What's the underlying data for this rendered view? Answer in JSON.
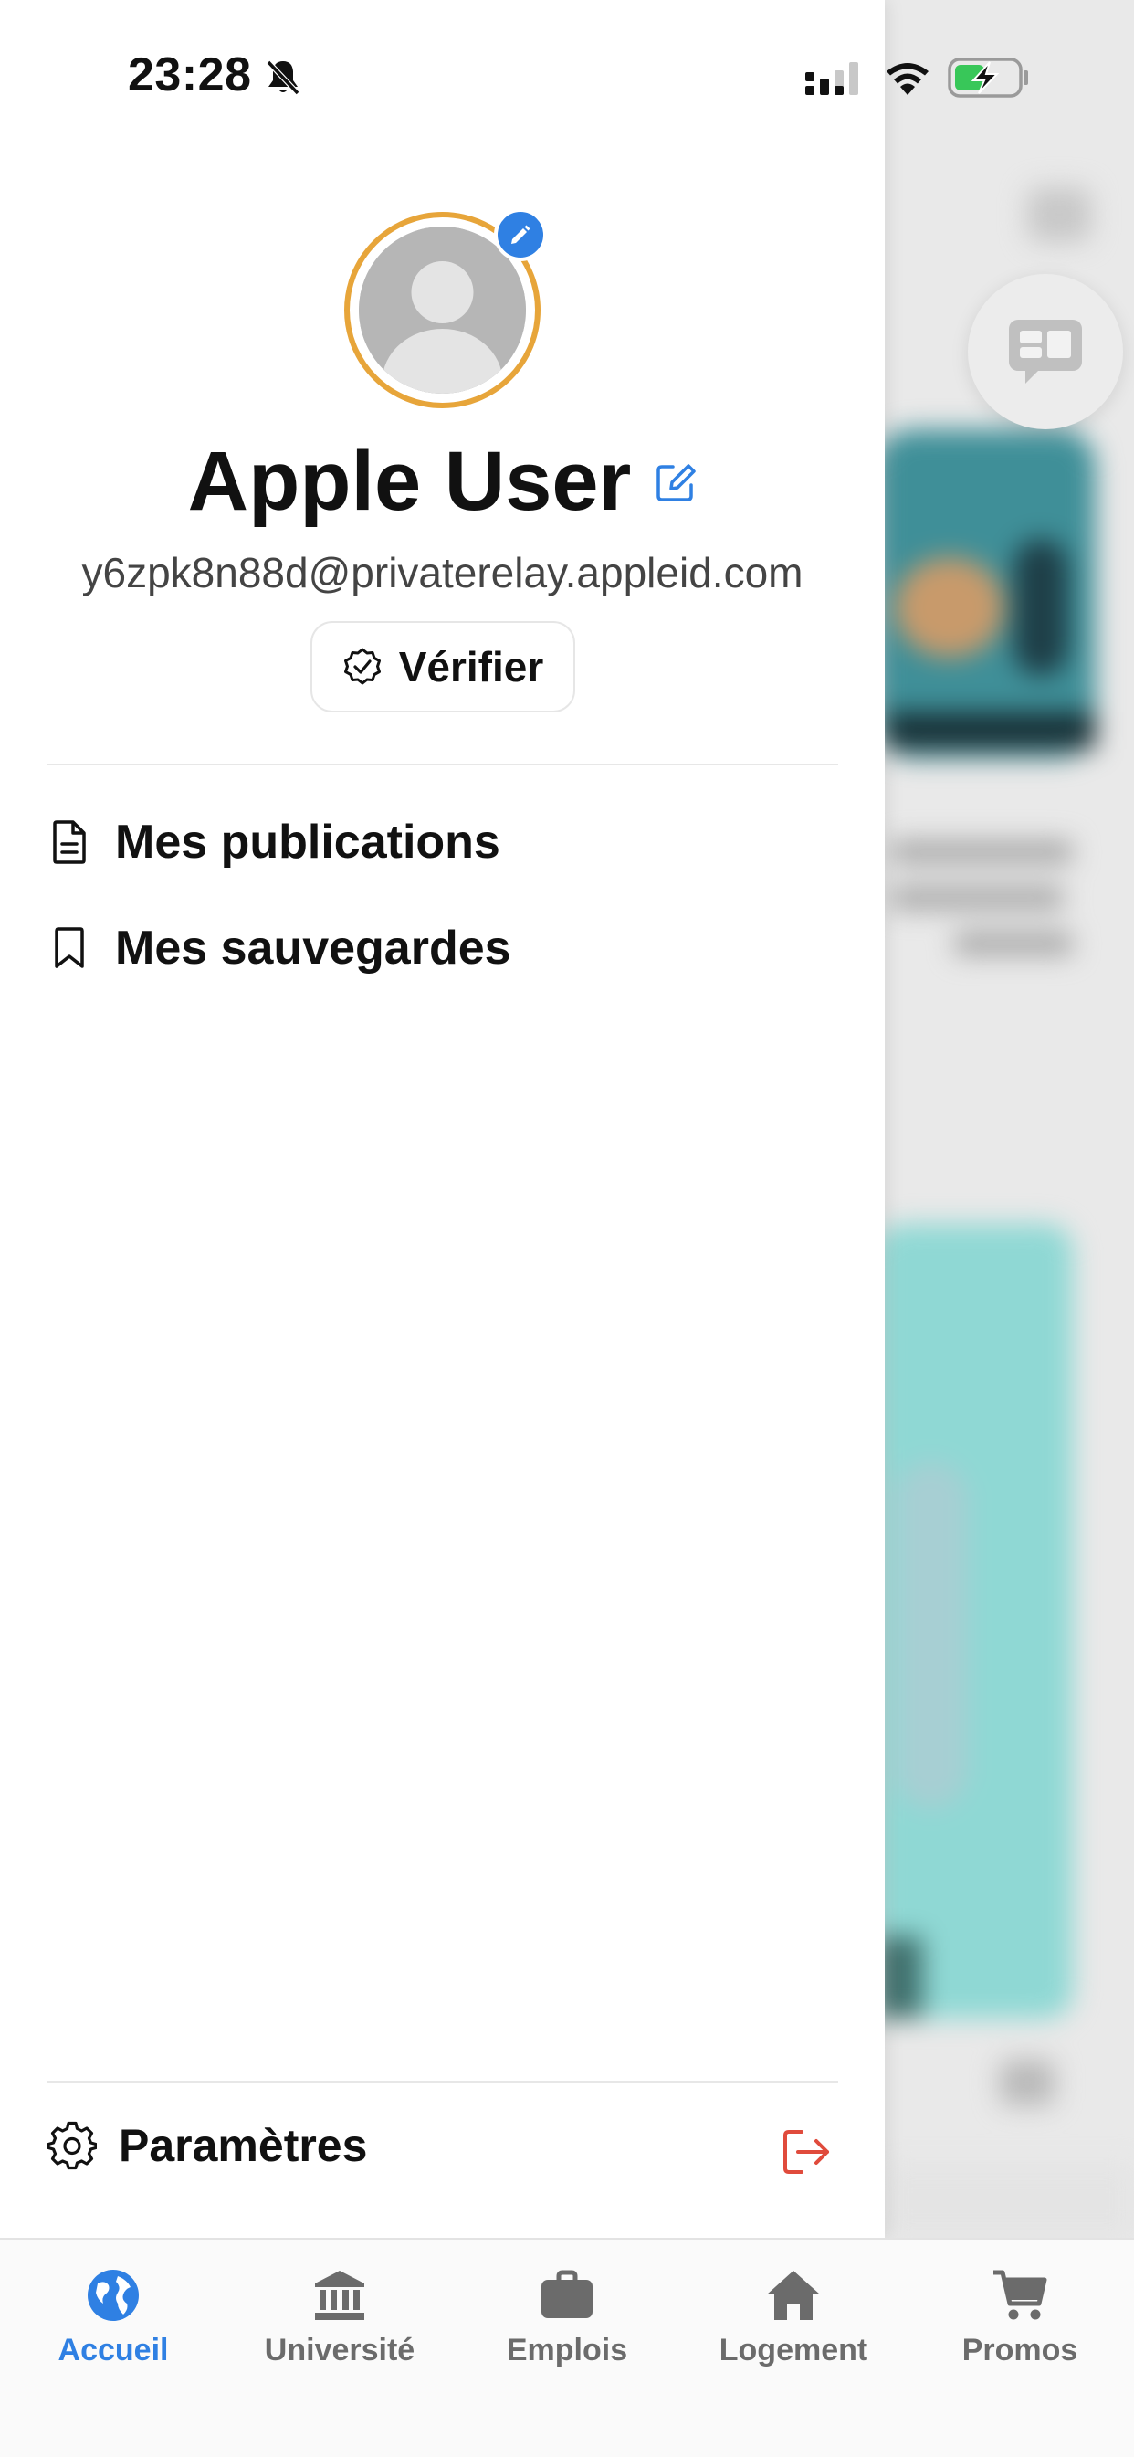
{
  "status_bar": {
    "time": "23:28"
  },
  "profile": {
    "name": "Apple User",
    "email": "y6zpk8n88d@privaterelay.appleid.com",
    "verify_label": "Vérifier"
  },
  "menu": {
    "items": [
      {
        "label": "Mes publications",
        "icon": "document-icon"
      },
      {
        "label": "Mes sauvegardes",
        "icon": "bookmark-icon"
      }
    ],
    "settings_label": "Paramètres"
  },
  "tabs": [
    {
      "label": "Accueil",
      "icon": "globe-icon",
      "active": true
    },
    {
      "label": "Université",
      "icon": "university-icon",
      "active": false
    },
    {
      "label": "Emplois",
      "icon": "briefcase-icon",
      "active": false
    },
    {
      "label": "Logement",
      "icon": "home-icon",
      "active": false
    },
    {
      "label": "Promos",
      "icon": "cart-icon",
      "active": false
    }
  ],
  "colors": {
    "accent": "#2f80e3",
    "avatar_ring": "#e7a53a",
    "logout": "#e04b3c",
    "inactive_tab": "#6b6b6b",
    "battery_fill": "#38c759"
  }
}
